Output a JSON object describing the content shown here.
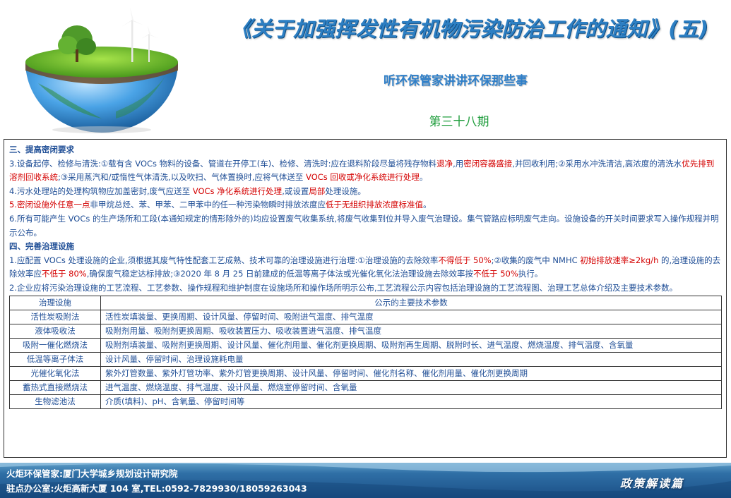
{
  "header": {
    "main_title": "《关于加强挥发性有机物污染防治工作的通知》(五)",
    "sub_title": "听环保管家讲讲环保那些事",
    "issue": "第三十八期"
  },
  "section3": {
    "title": "三、提高密闭要求",
    "p1": [
      {
        "t": "3.设备起停、检修与清洗:①载有含 VOCs 物料的设备、管道在开停工(车)、检修、清洗时:应在退料阶段尽量将残存物料"
      },
      {
        "t": "退净",
        "r": true
      },
      {
        "t": ",用"
      },
      {
        "t": "密闭容器盛接",
        "r": true
      },
      {
        "t": ",并回收利用;②采用水冲洗清洁,高浓度的清洗水"
      },
      {
        "t": "优先排到溶剂回收系统",
        "r": true
      },
      {
        "t": ";③采用蒸汽和/或惰性气体清洗,以及吹扫、气体置换时,应将气体送至 "
      },
      {
        "t": "VOCs 回收或净化系统进行处理",
        "r": true
      },
      {
        "t": "。"
      }
    ],
    "p2": [
      {
        "t": "4.污水处理站的处理构筑物应加盖密封,废气应送至 "
      },
      {
        "t": "VOCs 净化系统进行处理",
        "r": true
      },
      {
        "t": ",或设置"
      },
      {
        "t": "局部",
        "r": true
      },
      {
        "t": "处理设施。"
      }
    ],
    "p3": [
      {
        "t": "5.",
        "r": true
      },
      {
        "t": "密闭设施外任意一点",
        "r": true
      },
      {
        "t": "非甲烷总烃、苯、甲苯、二甲苯中的任一种污染物瞬时排放浓度应"
      },
      {
        "t": "低于无组织排放浓度标准值",
        "r": true
      },
      {
        "t": "。"
      }
    ],
    "p4": [
      {
        "t": "6.所有可能产生 VOCs 的生产场所和工段(本通知规定的情形除外的)均应设置废气收集系统,将废气收集到位并导入废气治理设。集气管路应标明废气走向。设施设备的开关时间要求写入操作规程并明示公布。"
      }
    ]
  },
  "section4": {
    "title": "四、完善治理设施",
    "p1": [
      {
        "t": "1.应配置 VOCs 处理设施的企业,须根据其废气特性配套工艺成熟、技术可靠的治理设施进行治理:①治理设施的去除效率"
      },
      {
        "t": "不得低于 50%",
        "r": true
      },
      {
        "t": ";②收集的废气中 NMHC "
      },
      {
        "t": "初始排放速率≥2kg/h",
        "r": true
      },
      {
        "t": " 的,治理设施的去除效率应"
      },
      {
        "t": "不低于 80%",
        "r": true
      },
      {
        "t": ",确保废气稳定达标排放;③2020 年 8 月 25 日前建成的低温等离子体法或光催化氧化法治理设施去除效率按"
      },
      {
        "t": "不低于 50%",
        "r": true
      },
      {
        "t": "执行。"
      }
    ],
    "p2": [
      {
        "t": "2.企业应将污染治理设施的工艺流程、工艺参数、操作规程和维护制度在设施场所和操作场所明示公布,工艺流程公示内容包括治理设施的工艺流程图、治理工艺总体介绍及主要技术参数。"
      }
    ]
  },
  "table": {
    "headers": [
      "治理设施",
      "公示的主要技术参数"
    ],
    "rows": [
      [
        "活性炭吸附法",
        "活性炭填装量、更换周期、设计风量、停留时间、吸附进气温度、排气温度"
      ],
      [
        "液体吸收法",
        "吸附剂用量、吸附剂更换周期、吸收装置压力、吸收装置进气温度、排气温度"
      ],
      [
        "吸附一催化燃烧法",
        "吸附剂填装量、吸附剂更换周期、设计风量、催化剂用量、催化剂更换周期、吸附剂再生周期、脱附时长、进气温度、燃烧温度、排气温度、含氧量"
      ],
      [
        "低温等离子体法",
        "设计风量、停留时间、治理设施耗电量"
      ],
      [
        "光催化氧化法",
        "紫外灯管数量、紫外灯管功率、紫外灯管更换周期、设计风量、停留时间、催化剂名称、催化剂用量、催化剂更换周期"
      ],
      [
        "蓄热式直接燃烧法",
        "进气温度、燃烧温度、排气温度、设计风量、燃烧室停留时间、含氧量"
      ],
      [
        "生物滤池法",
        "介质(填料)、pH、含氧量、停留时间等"
      ]
    ]
  },
  "footer": {
    "line1": "火炬环保管家:厦门大学城乡规划设计研究院",
    "line2": "驻点办公室:火炬高新大厦 104 室,TEL:0592-7829930/18059263043",
    "badge": "政策解读篇"
  }
}
